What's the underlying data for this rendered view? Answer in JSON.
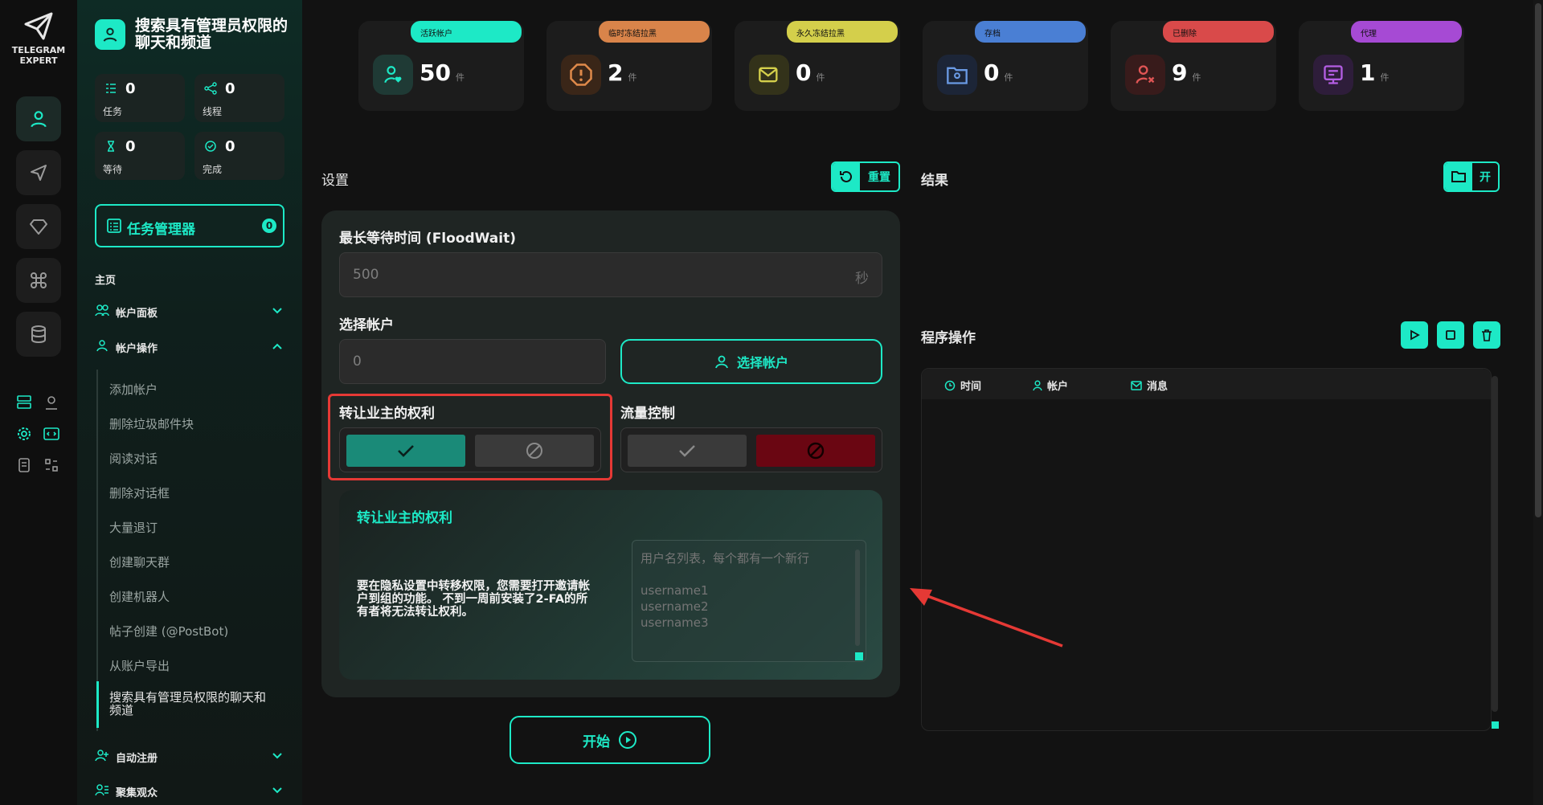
{
  "app": {
    "logo_line1": "TELEGRAM",
    "logo_line2": "EXPERT",
    "page_title": "搜索具有管理员权限的聊天和频道"
  },
  "colors": {
    "accent": "#1de9c6",
    "red_highlight": "#e53935"
  },
  "sidebar": {
    "stats": [
      {
        "value": "0",
        "label": "任务",
        "icon": "list-icon"
      },
      {
        "value": "0",
        "label": "线程",
        "icon": "share-icon"
      },
      {
        "value": "0",
        "label": "等待",
        "icon": "hourglass-icon"
      },
      {
        "value": "0",
        "label": "完成",
        "icon": "check-circle-icon"
      }
    ],
    "task_manager": {
      "label": "任务管理器",
      "count": "0"
    },
    "home_label": "主页",
    "groups": [
      {
        "label": "帐户面板",
        "expanded": false
      },
      {
        "label": "帐户操作",
        "expanded": true
      },
      {
        "label": "自动注册",
        "expanded": false
      },
      {
        "label": "聚集观众",
        "expanded": false
      }
    ],
    "sub_items": [
      "添加帐户",
      "删除垃圾邮件块",
      "阅读对话",
      "删除对话框",
      "大量退订",
      "创建聊天群",
      "创建机器人",
      "帖子创建 (@PostBot)",
      "从账户导出",
      "搜索具有管理员权限的聊天和频道"
    ]
  },
  "cards": [
    {
      "label": "活跃帐户",
      "count": "50",
      "unit": "件",
      "color": "#1de9c6",
      "icon": "user-heart-icon"
    },
    {
      "label": "临时冻结拉黑",
      "count": "2",
      "unit": "件",
      "color": "#d9844a",
      "icon": "alert-octagon-icon"
    },
    {
      "label": "永久冻结拉黑",
      "count": "0",
      "unit": "件",
      "color": "#d4cf4b",
      "icon": "mail-x-icon"
    },
    {
      "label": "存档",
      "count": "0",
      "unit": "件",
      "color": "#4a7fd4",
      "icon": "folder-user-icon"
    },
    {
      "label": "已删除",
      "count": "9",
      "unit": "件",
      "color": "#d94a4a",
      "icon": "user-x-icon"
    },
    {
      "label": "代理",
      "count": "1",
      "unit": "件",
      "color": "#a64ad4",
      "icon": "proxy-icon"
    }
  ],
  "settings": {
    "title": "设置",
    "reset_label": "重置",
    "flood_wait_label": "最长等待时间 (FloodWait)",
    "flood_wait_placeholder": "500",
    "flood_wait_unit": "秒",
    "select_accounts_label": "选择帐户",
    "select_accounts_value": "0",
    "select_accounts_button": "选择帐户",
    "transfer_owner_label": "转让业主的权利",
    "transfer_owner_enabled": true,
    "traffic_control_label": "流量控制",
    "traffic_control_enabled": false,
    "info_title": "转让业主的权利",
    "info_text": "要在隐私设置中转移权限，您需要打开邀请帐户到组的功能。 不到一周前安装了2-FA的所有者将无法转让权利。",
    "usernames_placeholder": "用户名列表，每个都有一个新行\n\nusername1\nusername2\nusername3",
    "start_label": "开始"
  },
  "results": {
    "title": "结果",
    "open_label": "开"
  },
  "program_ops": {
    "title": "程序操作",
    "columns": [
      "时间",
      "帐户",
      "消息"
    ]
  }
}
